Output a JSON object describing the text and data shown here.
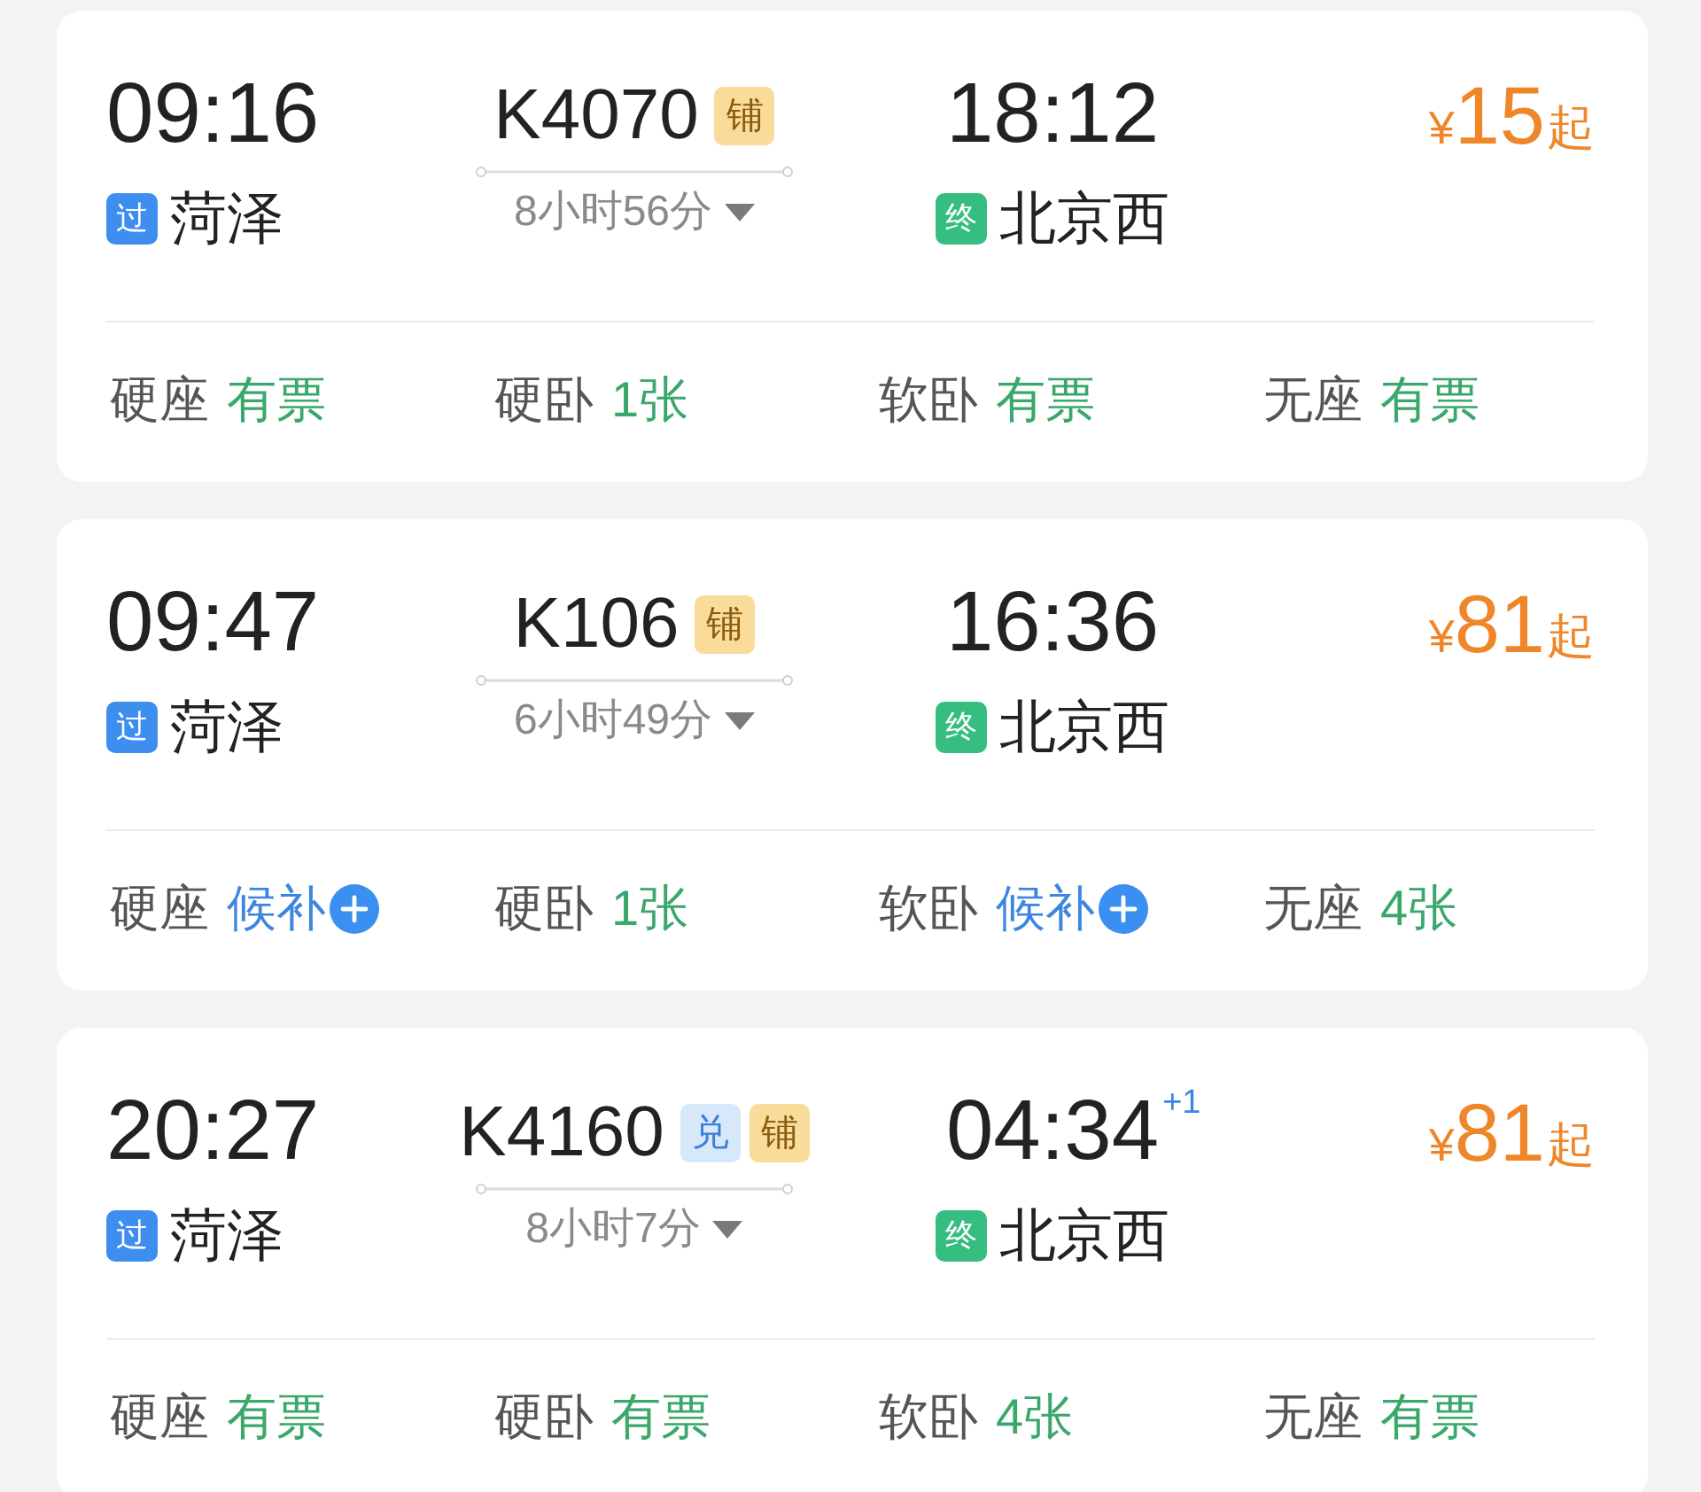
{
  "trains": [
    {
      "depart_time": "09:16",
      "depart_station": {
        "kind": "pass",
        "badge": "过",
        "name": "菏泽"
      },
      "train_no": "K4070",
      "tags": [
        {
          "kind": "berth",
          "text": "铺"
        }
      ],
      "duration": "8小时56分",
      "arrive_time": "18:12",
      "arrive_station": {
        "kind": "terminal",
        "badge": "终",
        "name": "北京西"
      },
      "price": {
        "currency": "¥",
        "amount": "15",
        "suffix": "起"
      },
      "seats": [
        {
          "kind": "available",
          "name": "硬座",
          "status": "有票"
        },
        {
          "kind": "available",
          "name": "硬卧",
          "status": "1张"
        },
        {
          "kind": "available",
          "name": "软卧",
          "status": "有票"
        },
        {
          "kind": "available",
          "name": "无座",
          "status": "有票"
        }
      ]
    },
    {
      "depart_time": "09:47",
      "depart_station": {
        "kind": "pass",
        "badge": "过",
        "name": "菏泽"
      },
      "train_no": "K106",
      "tags": [
        {
          "kind": "berth",
          "text": "铺"
        }
      ],
      "duration": "6小时49分",
      "arrive_time": "16:36",
      "arrive_station": {
        "kind": "terminal",
        "badge": "终",
        "name": "北京西"
      },
      "price": {
        "currency": "¥",
        "amount": "81",
        "suffix": "起"
      },
      "seats": [
        {
          "kind": "waitlist",
          "name": "硬座",
          "status": "候补"
        },
        {
          "kind": "available",
          "name": "硬卧",
          "status": "1张"
        },
        {
          "kind": "waitlist",
          "name": "软卧",
          "status": "候补"
        },
        {
          "kind": "available",
          "name": "无座",
          "status": "4张"
        }
      ]
    },
    {
      "depart_time": "20:27",
      "depart_station": {
        "kind": "pass",
        "badge": "过",
        "name": "菏泽"
      },
      "train_no": "K4160",
      "tags": [
        {
          "kind": "exchange",
          "text": "兑"
        },
        {
          "kind": "berth",
          "text": "铺"
        }
      ],
      "duration": "8小时7分",
      "arrive_time": "04:34",
      "day_offset": "+1",
      "arrive_station": {
        "kind": "terminal",
        "badge": "终",
        "name": "北京西"
      },
      "price": {
        "currency": "¥",
        "amount": "81",
        "suffix": "起"
      },
      "seats": [
        {
          "kind": "available",
          "name": "硬座",
          "status": "有票"
        },
        {
          "kind": "available",
          "name": "硬卧",
          "status": "有票"
        },
        {
          "kind": "available",
          "name": "软卧",
          "status": "4张"
        },
        {
          "kind": "available",
          "name": "无座",
          "status": "有票"
        }
      ]
    }
  ]
}
